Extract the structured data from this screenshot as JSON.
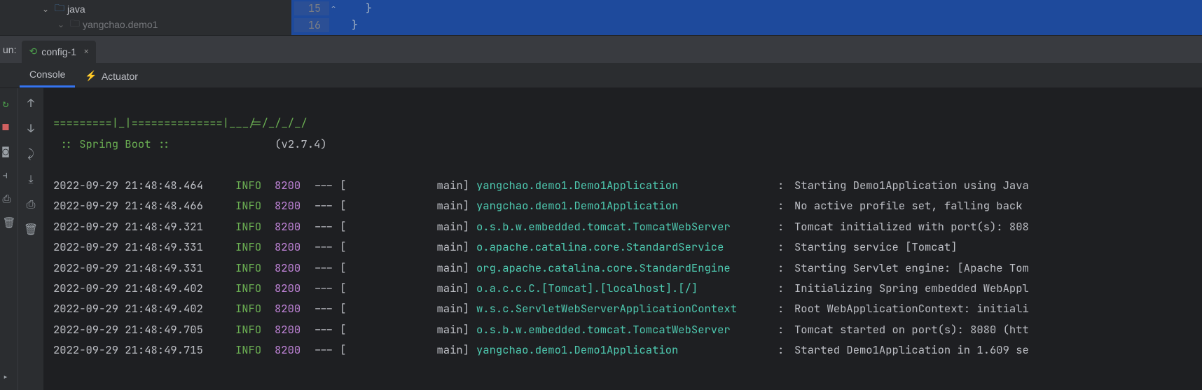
{
  "tree": {
    "item1": {
      "label": "java"
    },
    "item2": {
      "label": "yangchao.demo1"
    }
  },
  "editor": {
    "line1_num": "15",
    "line1_code": "}",
    "line2_num": "16",
    "line2_code": "}"
  },
  "run": {
    "label": "un:",
    "tab": "config-1"
  },
  "tabs": {
    "console": "Console",
    "actuator": "Actuator"
  },
  "banner": {
    "line1": "=========|_|==============|___/=/_/_/_/",
    "line2a": " :: Spring Boot :: ",
    "line2b": "               ",
    "version": "(v2.7.4)"
  },
  "logs": [
    {
      "ts": "2022-09-29 21:48:48.464",
      "level": "INFO",
      "pid": "8200",
      "sep": "--- [",
      "thread": "main]",
      "logger": "yangchao.demo1.Demo1Application",
      "msg": "Starting Demo1Application using Java"
    },
    {
      "ts": "2022-09-29 21:48:48.466",
      "level": "INFO",
      "pid": "8200",
      "sep": "--- [",
      "thread": "main]",
      "logger": "yangchao.demo1.Demo1Application",
      "msg": "No active profile set, falling back "
    },
    {
      "ts": "2022-09-29 21:48:49.321",
      "level": "INFO",
      "pid": "8200",
      "sep": "--- [",
      "thread": "main]",
      "logger": "o.s.b.w.embedded.tomcat.TomcatWebServer",
      "msg": "Tomcat initialized with port(s): 808"
    },
    {
      "ts": "2022-09-29 21:48:49.331",
      "level": "INFO",
      "pid": "8200",
      "sep": "--- [",
      "thread": "main]",
      "logger": "o.apache.catalina.core.StandardService",
      "msg": "Starting service [Tomcat]"
    },
    {
      "ts": "2022-09-29 21:48:49.331",
      "level": "INFO",
      "pid": "8200",
      "sep": "--- [",
      "thread": "main]",
      "logger": "org.apache.catalina.core.StandardEngine",
      "msg": "Starting Servlet engine: [Apache Tom"
    },
    {
      "ts": "2022-09-29 21:48:49.402",
      "level": "INFO",
      "pid": "8200",
      "sep": "--- [",
      "thread": "main]",
      "logger": "o.a.c.c.C.[Tomcat].[localhost].[/]",
      "msg": "Initializing Spring embedded WebAppl"
    },
    {
      "ts": "2022-09-29 21:48:49.402",
      "level": "INFO",
      "pid": "8200",
      "sep": "--- [",
      "thread": "main]",
      "logger": "w.s.c.ServletWebServerApplicationContext",
      "msg": "Root WebApplicationContext: initiali"
    },
    {
      "ts": "2022-09-29 21:48:49.705",
      "level": "INFO",
      "pid": "8200",
      "sep": "--- [",
      "thread": "main]",
      "logger": "o.s.b.w.embedded.tomcat.TomcatWebServer",
      "msg": "Tomcat started on port(s): 8080 (htt"
    },
    {
      "ts": "2022-09-29 21:48:49.715",
      "level": "INFO",
      "pid": "8200",
      "sep": "--- [",
      "thread": "main]",
      "logger": "yangchao.demo1.Demo1Application",
      "msg": "Started Demo1Application in 1.609 se"
    }
  ]
}
